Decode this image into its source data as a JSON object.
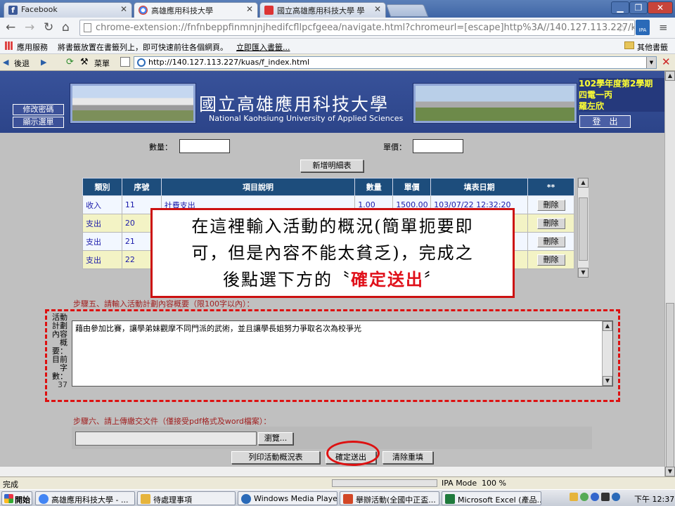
{
  "tabs": [
    {
      "label": "Facebook",
      "color": "#3b5998",
      "icon_text": "f"
    },
    {
      "label": "高雄應用科技大學",
      "color": "#4285f4",
      "icon_text": ""
    },
    {
      "label": "國立高雄應用科技大學 學",
      "color": "#d33",
      "icon_text": ""
    }
  ],
  "omnibox": {
    "url": "chrome-extension://fnfnbeppfinmnjnjhedifcfllpcfgeea/navigate.html?chromeurl=[escape]http%3A//140.127.113.227/kuas/ind"
  },
  "bookmarks": {
    "apps": "應用服務",
    "hint": "將書籤放置在書籤列上，即可快速前往各個網頁。",
    "import_link": "立即匯入書籤...",
    "other": "其他書籤"
  },
  "ie_toolbar": {
    "back": "後退",
    "menu": "菜單",
    "address": "http://140.127.113.227/kuas/f_index.html"
  },
  "banner": {
    "title_zh": "國立高雄應用科技大學",
    "title_en": "National Kaohsiung University of Applied Sciences",
    "change_pwd": "修改密碼",
    "show_menu": "顯示選單",
    "semester": "102學年度第2學期",
    "dept": "四電一丙",
    "user": "羅左欣",
    "logout": "登　出"
  },
  "form": {
    "qty_label": "數量：",
    "price_label": "單價：",
    "add_button": "新增明細表"
  },
  "table": {
    "headers": [
      "類別",
      "序號",
      "項目說明",
      "數量",
      "單價",
      "填表日期",
      "**"
    ],
    "rows": [
      {
        "type": "收入",
        "seq": "11",
        "desc": "社費支出",
        "qty": "1.00",
        "price": "1500.00",
        "date": "103/07/22 12:32:20",
        "action": "刪除"
      },
      {
        "type": "支出",
        "seq": "20",
        "desc": "",
        "qty": "",
        "price": "",
        "date": "",
        "action": "刪除"
      },
      {
        "type": "支出",
        "seq": "21",
        "desc": "",
        "qty": "",
        "price": "",
        "date": "",
        "action": "刪除"
      },
      {
        "type": "支出",
        "seq": "22",
        "desc": "",
        "qty": "",
        "price": "",
        "date": "",
        "action": "刪除"
      }
    ]
  },
  "callout": {
    "line1": "在這裡輸入活動的概況(簡單扼要即",
    "line2": "可，但是內容不能太貧乏)，完成之",
    "line3_pre": "後點選下方的〝",
    "line3_red": "確定送出",
    "line3_post": "〞"
  },
  "step5": {
    "label": "步驟五、請輸入活動計劃內容概要（限100字以內）：",
    "side_label": "活動計劃內容概要：目前字數：",
    "count": "37",
    "content": "藉由參加比賽，讓學弟妹觀摩不同門派的武術，並且讓學長姐努力爭取名次為校爭光"
  },
  "step6": {
    "label": "步驟六、請上傳繳交文件（僅接受pdf格式及word檔案）：",
    "browse": "瀏覽...",
    "print_btn": "列印活動概況表",
    "submit_btn": "確定送出",
    "clear_btn": "清除重填"
  },
  "status": {
    "text": "完成",
    "ipa": "IPA Mode",
    "zoom": "100 %"
  },
  "taskbar": {
    "start": "開始",
    "items": [
      {
        "label": "高雄應用科技大學 - ...",
        "color": "#4285f4"
      },
      {
        "label": "待處理事項",
        "color": "#e6b43c"
      },
      {
        "label": "Windows Media Player",
        "color": "#2a6ab8"
      },
      {
        "label": "舉辦活動(全國中正盃...",
        "color": "#d24726"
      },
      {
        "label": "Microsoft Excel (產品...",
        "color": "#1f7a3c"
      }
    ],
    "clock": "下午 12:37"
  }
}
